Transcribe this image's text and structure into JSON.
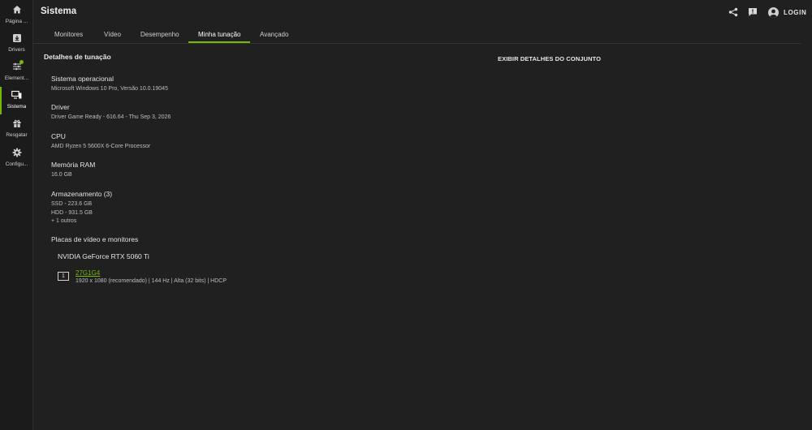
{
  "sidebar": {
    "items": [
      {
        "label": "Página ...",
        "icon": "home-icon"
      },
      {
        "label": "Drivers",
        "icon": "drivers-icon"
      },
      {
        "label": "Element...",
        "icon": "sliders-icon"
      },
      {
        "label": "Sistema",
        "icon": "system-icon",
        "active": true
      },
      {
        "label": "Resgatar",
        "icon": "gift-icon"
      },
      {
        "label": "Configu...",
        "icon": "gear-icon"
      }
    ]
  },
  "header": {
    "title": "Sistema",
    "login_label": "LOGIN",
    "icons": [
      "share-icon",
      "feedback-icon",
      "user-avatar-icon"
    ]
  },
  "tabs": [
    {
      "label": "Monitores"
    },
    {
      "label": "Vídeo"
    },
    {
      "label": "Desempenho"
    },
    {
      "label": "Minha tunação",
      "active": true
    },
    {
      "label": "Avançado"
    }
  ],
  "main": {
    "section_title": "Detalhes de tunação",
    "details_link": "EXIBIR DETALHES DO CONJUNTO",
    "specs": {
      "os": {
        "title": "Sistema operacional",
        "value": "Microsoft Windows 10 Pro, Versão 10.0.19045"
      },
      "driver": {
        "title": "Driver",
        "value": "Driver Game Ready - 616.64 - Thu Sep 3, 2026"
      },
      "cpu": {
        "title": "CPU",
        "value": "AMD Ryzen 5 5600X 6-Core Processor"
      },
      "ram": {
        "title": "Memória RAM",
        "value": "16.0 GB"
      },
      "storage": {
        "title": "Armazenamento (3)",
        "lines": [
          "SSD - 223.6 GB",
          "HDD - 931.5 GB",
          "+ 1 outros"
        ]
      }
    },
    "gpu_section_title": "Placas de vídeo e monitores",
    "gpu_name": "NVIDIA GeForce RTX 5060 Ti",
    "monitor": {
      "index": "1",
      "name": "27G1G4",
      "spec": "1920 x 1080 (recomendado) | 144 Hz | Alta (32 bits) | HDCP"
    }
  },
  "colors": {
    "accent": "#76b900",
    "background": "#202020",
    "sidebar": "#1b1b1b"
  }
}
